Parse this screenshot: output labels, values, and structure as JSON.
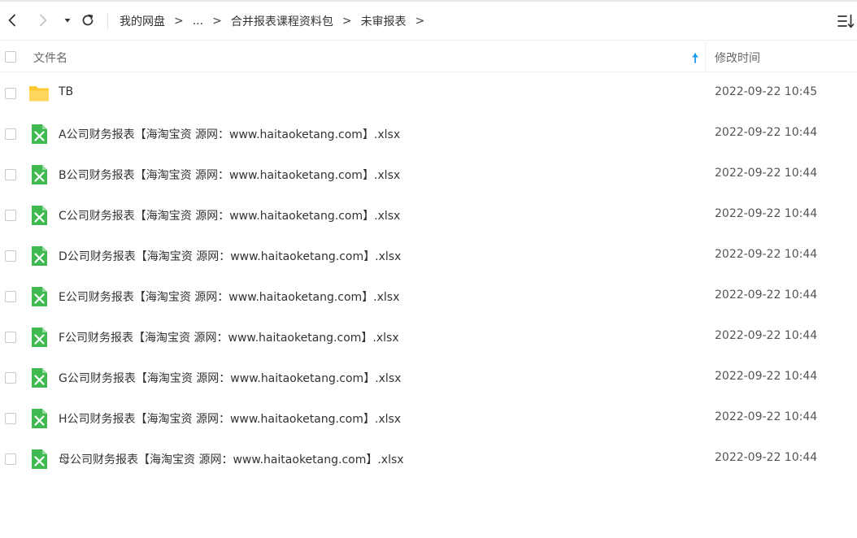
{
  "colors": {
    "accent": "#1a9bf0",
    "folder": "#ffcc3a",
    "excel": "#3fb950",
    "text": "#333333",
    "muted": "#666666"
  },
  "toolbar": {
    "back_icon": "chevron-left-icon",
    "forward_icon": "chevron-right-icon",
    "history_icon": "caret-down-icon",
    "refresh_icon": "refresh-icon",
    "sort_view_icon": "sort-list-icon"
  },
  "breadcrumb": {
    "items": [
      "我的网盘",
      "...",
      "合并报表课程资料包",
      "未审报表"
    ],
    "separator": ">"
  },
  "header": {
    "name_label": "文件名",
    "time_label": "修改时间",
    "sort_icon": "arrow-up-icon"
  },
  "files": [
    {
      "name": "TB",
      "type": "folder",
      "icon": "folder-icon",
      "time": "2022-09-22 10:45"
    },
    {
      "name": "A公司财务报表【海淘宝资 源网：www.haitaoketang.com】.xlsx",
      "type": "xlsx",
      "icon": "excel-file-icon",
      "time": "2022-09-22 10:44"
    },
    {
      "name": "B公司财务报表【海淘宝资 源网：www.haitaoketang.com】.xlsx",
      "type": "xlsx",
      "icon": "excel-file-icon",
      "time": "2022-09-22 10:44"
    },
    {
      "name": "C公司财务报表【海淘宝资 源网：www.haitaoketang.com】.xlsx",
      "type": "xlsx",
      "icon": "excel-file-icon",
      "time": "2022-09-22 10:44"
    },
    {
      "name": "D公司财务报表【海淘宝资 源网：www.haitaoketang.com】.xlsx",
      "type": "xlsx",
      "icon": "excel-file-icon",
      "time": "2022-09-22 10:44"
    },
    {
      "name": "E公司财务报表【海淘宝资 源网：www.haitaoketang.com】.xlsx",
      "type": "xlsx",
      "icon": "excel-file-icon",
      "time": "2022-09-22 10:44"
    },
    {
      "name": "F公司财务报表【海淘宝资 源网：www.haitaoketang.com】.xlsx",
      "type": "xlsx",
      "icon": "excel-file-icon",
      "time": "2022-09-22 10:44"
    },
    {
      "name": "G公司财务报表【海淘宝资 源网：www.haitaoketang.com】.xlsx",
      "type": "xlsx",
      "icon": "excel-file-icon",
      "time": "2022-09-22 10:44"
    },
    {
      "name": "H公司财务报表【海淘宝资 源网：www.haitaoketang.com】.xlsx",
      "type": "xlsx",
      "icon": "excel-file-icon",
      "time": "2022-09-22 10:44"
    },
    {
      "name": "母公司财务报表【海淘宝资 源网：www.haitaoketang.com】.xlsx",
      "type": "xlsx",
      "icon": "excel-file-icon",
      "time": "2022-09-22 10:44"
    }
  ]
}
